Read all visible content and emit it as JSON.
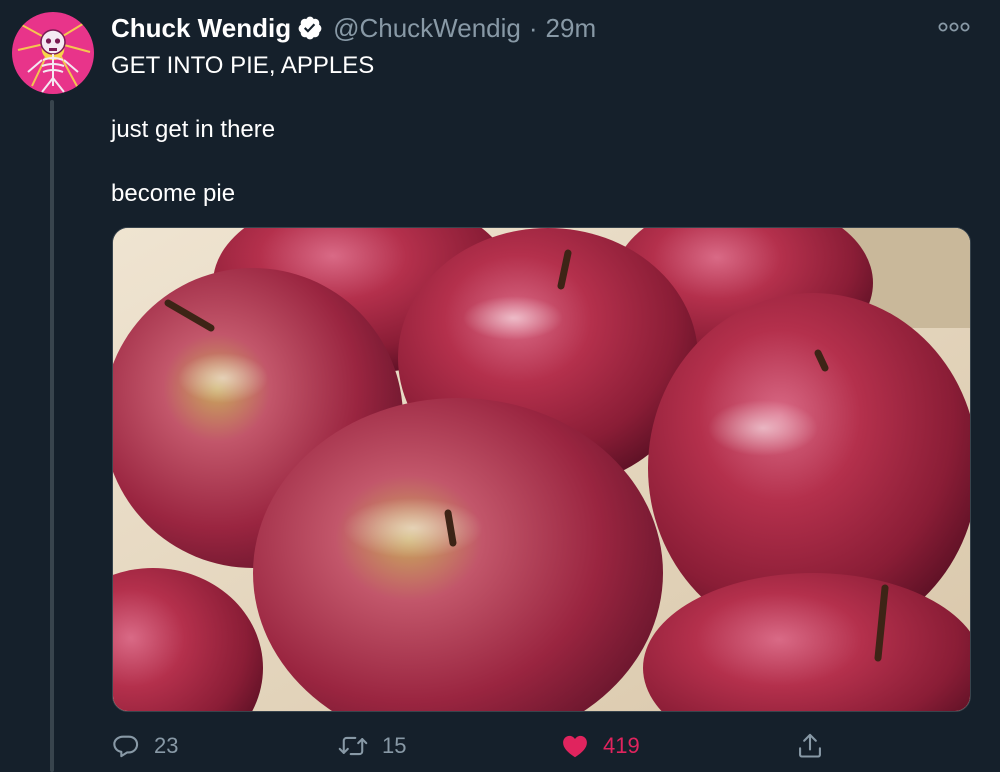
{
  "tweet": {
    "author": {
      "display_name": "Chuck Wendig",
      "handle": "@ChuckWendig",
      "verified": true
    },
    "separator": "·",
    "timestamp": "29m",
    "text_lines": [
      "GET INTO PIE, APPLES",
      "just get in there",
      "become pie"
    ],
    "media": {
      "alt": "Red apples"
    },
    "actions": {
      "reply_count": "23",
      "retweet_count": "15",
      "like_count": "419",
      "liked": true
    }
  },
  "colors": {
    "background": "#15202b",
    "text_primary": "#ffffff",
    "text_secondary": "#8899a6",
    "verified": "#ffffff",
    "like": "#e0245e",
    "border": "#38444d"
  },
  "icons": {
    "reply": "reply-icon",
    "retweet": "retweet-icon",
    "like": "heart-icon",
    "share": "share-icon",
    "more": "more-icon",
    "verified": "verified-badge-icon"
  }
}
